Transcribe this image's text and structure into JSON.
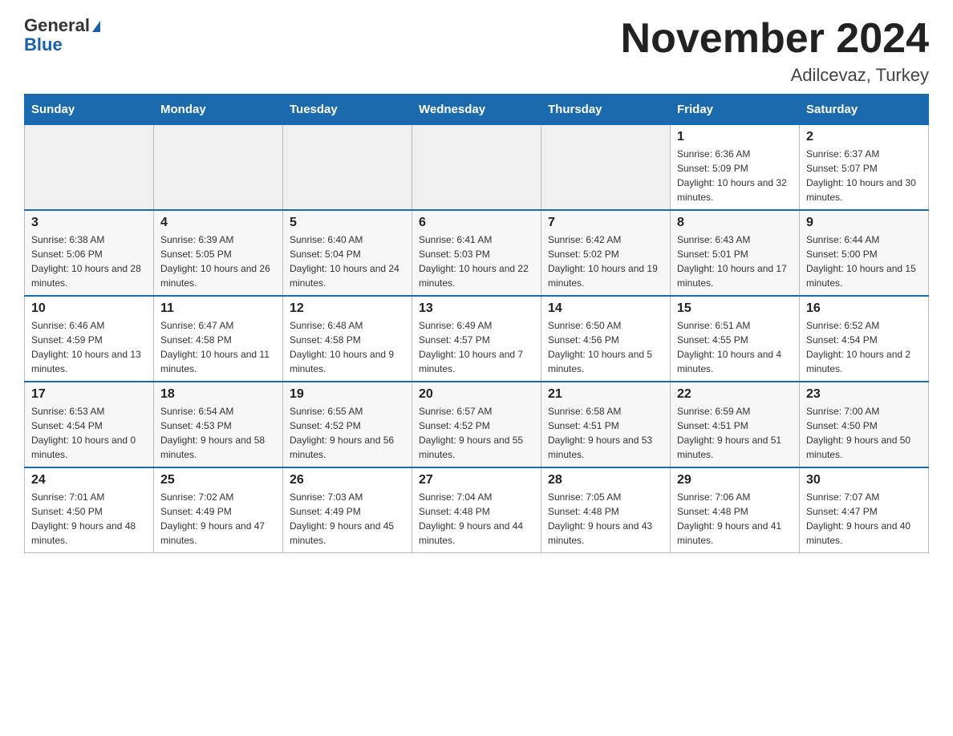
{
  "header": {
    "logo_general": "General",
    "logo_blue": "Blue",
    "month_title": "November 2024",
    "location": "Adilcevaz, Turkey"
  },
  "weekdays": [
    "Sunday",
    "Monday",
    "Tuesday",
    "Wednesday",
    "Thursday",
    "Friday",
    "Saturday"
  ],
  "weeks": [
    [
      {
        "day": "",
        "info": ""
      },
      {
        "day": "",
        "info": ""
      },
      {
        "day": "",
        "info": ""
      },
      {
        "day": "",
        "info": ""
      },
      {
        "day": "",
        "info": ""
      },
      {
        "day": "1",
        "info": "Sunrise: 6:36 AM\nSunset: 5:09 PM\nDaylight: 10 hours and 32 minutes."
      },
      {
        "day": "2",
        "info": "Sunrise: 6:37 AM\nSunset: 5:07 PM\nDaylight: 10 hours and 30 minutes."
      }
    ],
    [
      {
        "day": "3",
        "info": "Sunrise: 6:38 AM\nSunset: 5:06 PM\nDaylight: 10 hours and 28 minutes."
      },
      {
        "day": "4",
        "info": "Sunrise: 6:39 AM\nSunset: 5:05 PM\nDaylight: 10 hours and 26 minutes."
      },
      {
        "day": "5",
        "info": "Sunrise: 6:40 AM\nSunset: 5:04 PM\nDaylight: 10 hours and 24 minutes."
      },
      {
        "day": "6",
        "info": "Sunrise: 6:41 AM\nSunset: 5:03 PM\nDaylight: 10 hours and 22 minutes."
      },
      {
        "day": "7",
        "info": "Sunrise: 6:42 AM\nSunset: 5:02 PM\nDaylight: 10 hours and 19 minutes."
      },
      {
        "day": "8",
        "info": "Sunrise: 6:43 AM\nSunset: 5:01 PM\nDaylight: 10 hours and 17 minutes."
      },
      {
        "day": "9",
        "info": "Sunrise: 6:44 AM\nSunset: 5:00 PM\nDaylight: 10 hours and 15 minutes."
      }
    ],
    [
      {
        "day": "10",
        "info": "Sunrise: 6:46 AM\nSunset: 4:59 PM\nDaylight: 10 hours and 13 minutes."
      },
      {
        "day": "11",
        "info": "Sunrise: 6:47 AM\nSunset: 4:58 PM\nDaylight: 10 hours and 11 minutes."
      },
      {
        "day": "12",
        "info": "Sunrise: 6:48 AM\nSunset: 4:58 PM\nDaylight: 10 hours and 9 minutes."
      },
      {
        "day": "13",
        "info": "Sunrise: 6:49 AM\nSunset: 4:57 PM\nDaylight: 10 hours and 7 minutes."
      },
      {
        "day": "14",
        "info": "Sunrise: 6:50 AM\nSunset: 4:56 PM\nDaylight: 10 hours and 5 minutes."
      },
      {
        "day": "15",
        "info": "Sunrise: 6:51 AM\nSunset: 4:55 PM\nDaylight: 10 hours and 4 minutes."
      },
      {
        "day": "16",
        "info": "Sunrise: 6:52 AM\nSunset: 4:54 PM\nDaylight: 10 hours and 2 minutes."
      }
    ],
    [
      {
        "day": "17",
        "info": "Sunrise: 6:53 AM\nSunset: 4:54 PM\nDaylight: 10 hours and 0 minutes."
      },
      {
        "day": "18",
        "info": "Sunrise: 6:54 AM\nSunset: 4:53 PM\nDaylight: 9 hours and 58 minutes."
      },
      {
        "day": "19",
        "info": "Sunrise: 6:55 AM\nSunset: 4:52 PM\nDaylight: 9 hours and 56 minutes."
      },
      {
        "day": "20",
        "info": "Sunrise: 6:57 AM\nSunset: 4:52 PM\nDaylight: 9 hours and 55 minutes."
      },
      {
        "day": "21",
        "info": "Sunrise: 6:58 AM\nSunset: 4:51 PM\nDaylight: 9 hours and 53 minutes."
      },
      {
        "day": "22",
        "info": "Sunrise: 6:59 AM\nSunset: 4:51 PM\nDaylight: 9 hours and 51 minutes."
      },
      {
        "day": "23",
        "info": "Sunrise: 7:00 AM\nSunset: 4:50 PM\nDaylight: 9 hours and 50 minutes."
      }
    ],
    [
      {
        "day": "24",
        "info": "Sunrise: 7:01 AM\nSunset: 4:50 PM\nDaylight: 9 hours and 48 minutes."
      },
      {
        "day": "25",
        "info": "Sunrise: 7:02 AM\nSunset: 4:49 PM\nDaylight: 9 hours and 47 minutes."
      },
      {
        "day": "26",
        "info": "Sunrise: 7:03 AM\nSunset: 4:49 PM\nDaylight: 9 hours and 45 minutes."
      },
      {
        "day": "27",
        "info": "Sunrise: 7:04 AM\nSunset: 4:48 PM\nDaylight: 9 hours and 44 minutes."
      },
      {
        "day": "28",
        "info": "Sunrise: 7:05 AM\nSunset: 4:48 PM\nDaylight: 9 hours and 43 minutes."
      },
      {
        "day": "29",
        "info": "Sunrise: 7:06 AM\nSunset: 4:48 PM\nDaylight: 9 hours and 41 minutes."
      },
      {
        "day": "30",
        "info": "Sunrise: 7:07 AM\nSunset: 4:47 PM\nDaylight: 9 hours and 40 minutes."
      }
    ]
  ]
}
